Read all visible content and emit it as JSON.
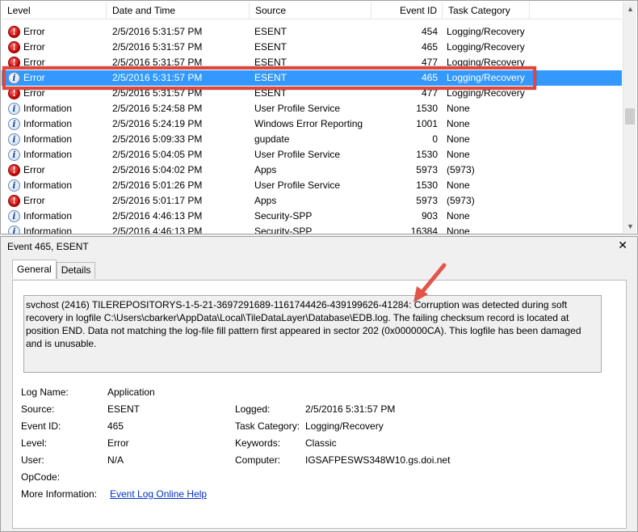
{
  "columns": [
    "Level",
    "Date and Time",
    "Source",
    "Event ID",
    "Task Category"
  ],
  "events": [
    {
      "level": "Error",
      "date": "2/5/2016 5:31:57 PM",
      "source": "ESENT",
      "id": "454",
      "category": "Logging/Recovery",
      "icon": "error-icon"
    },
    {
      "level": "Error",
      "date": "2/5/2016 5:31:57 PM",
      "source": "ESENT",
      "id": "465",
      "category": "Logging/Recovery",
      "icon": "error-icon"
    },
    {
      "level": "Error",
      "date": "2/5/2016 5:31:57 PM",
      "source": "ESENT",
      "id": "477",
      "category": "Logging/Recovery",
      "icon": "error-icon"
    },
    {
      "level": "Error",
      "date": "2/5/2016 5:31:57 PM",
      "source": "ESENT",
      "id": "465",
      "category": "Logging/Recovery",
      "icon": "info-icon",
      "selected": true
    },
    {
      "level": "Error",
      "date": "2/5/2016 5:31:57 PM",
      "source": "ESENT",
      "id": "477",
      "category": "Logging/Recovery",
      "icon": "error-icon"
    },
    {
      "level": "Information",
      "date": "2/5/2016 5:24:58 PM",
      "source": "User Profile Service",
      "id": "1530",
      "category": "None",
      "icon": "info-icon"
    },
    {
      "level": "Information",
      "date": "2/5/2016 5:24:19 PM",
      "source": "Windows Error Reporting",
      "id": "1001",
      "category": "None",
      "icon": "info-icon"
    },
    {
      "level": "Information",
      "date": "2/5/2016 5:09:33 PM",
      "source": "gupdate",
      "id": "0",
      "category": "None",
      "icon": "info-icon"
    },
    {
      "level": "Information",
      "date": "2/5/2016 5:04:05 PM",
      "source": "User Profile Service",
      "id": "1530",
      "category": "None",
      "icon": "info-icon"
    },
    {
      "level": "Error",
      "date": "2/5/2016 5:04:02 PM",
      "source": "Apps",
      "id": "5973",
      "category": "(5973)",
      "icon": "error-icon"
    },
    {
      "level": "Information",
      "date": "2/5/2016 5:01:26 PM",
      "source": "User Profile Service",
      "id": "1530",
      "category": "None",
      "icon": "info-icon"
    },
    {
      "level": "Error",
      "date": "2/5/2016 5:01:17 PM",
      "source": "Apps",
      "id": "5973",
      "category": "(5973)",
      "icon": "error-icon"
    },
    {
      "level": "Information",
      "date": "2/5/2016 4:46:13 PM",
      "source": "Security-SPP",
      "id": "903",
      "category": "None",
      "icon": "info-icon"
    },
    {
      "level": "Information",
      "date": "2/5/2016 4:46:13 PM",
      "source": "Security-SPP",
      "id": "16384",
      "category": "None",
      "icon": "info-icon"
    }
  ],
  "details": {
    "title": "Event 465, ESENT",
    "tabs": [
      "General",
      "Details"
    ],
    "description": "svchost (2416) TILEREPOSITORYS-1-5-21-3697291689-1161744426-439199626-41284: Corruption was detected during soft recovery in logfile C:\\Users\\cbarker\\AppData\\Local\\TileDataLayer\\Database\\EDB.log. The failing checksum record is located at position END. Data not matching the log-file fill pattern first appeared in sector 202 (0x000000CA). This logfile has been damaged and is unusable.",
    "labels": {
      "log_name": "Log Name:",
      "source": "Source:",
      "event_id": "Event ID:",
      "level": "Level:",
      "user": "User:",
      "opcode": "OpCode:",
      "more_info": "More Information:",
      "logged": "Logged:",
      "task_category": "Task Category:",
      "keywords": "Keywords:",
      "computer": "Computer:"
    },
    "values": {
      "log_name": "Application",
      "source": "ESENT",
      "event_id": "465",
      "level": "Error",
      "user": "N/A",
      "opcode": "",
      "more_info_link": "Event Log Online Help",
      "logged": "2/5/2016 5:31:57 PM",
      "task_category": "Logging/Recovery",
      "keywords": "Classic",
      "computer": "IGSAFPESWS348W10.gs.doi.net"
    }
  },
  "colors": {
    "selection": "#3399ff",
    "highlight_box": "#e0463c",
    "arrow": "#e0574a",
    "error_icon": "#c00000",
    "link": "#0033cc"
  }
}
